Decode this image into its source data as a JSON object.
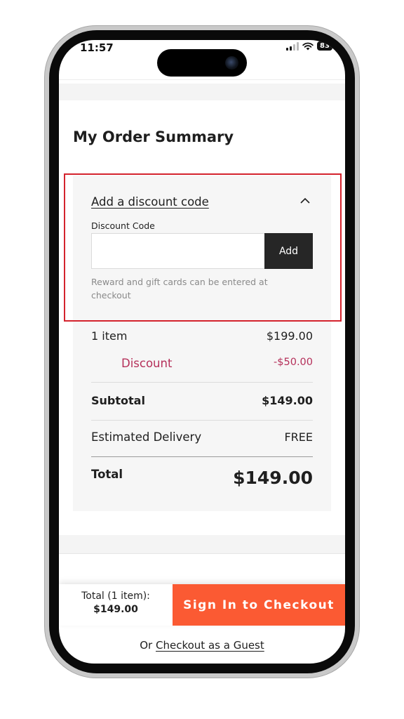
{
  "status_bar": {
    "time": "11:57",
    "battery": "83",
    "signal_icon": "cellular-signal-icon",
    "wifi_icon": "wifi-icon"
  },
  "order_summary": {
    "title": "My Order Summary"
  },
  "discount": {
    "toggle_label": "Add a discount code",
    "toggle_icon": "chevron-up-icon",
    "expanded": true,
    "field_label": "Discount Code",
    "input_value": "",
    "placeholder": "",
    "add_label": "Add",
    "hint": "Reward and gift cards can be entered at checkout"
  },
  "summary_rows": {
    "items_label": "1 item",
    "items_value": "$199.00",
    "discount_label": "Discount",
    "discount_value": "-$50.00",
    "subtotal_label": "Subtotal",
    "subtotal_value": "$149.00",
    "delivery_label": "Estimated Delivery",
    "delivery_value": "FREE",
    "total_label": "Total",
    "total_value": "$149.00"
  },
  "checkout_bar": {
    "total_label": "Total (1 item):",
    "total_value": "$149.00",
    "sign_in_label": "Sign In to Checkout"
  },
  "guest": {
    "prefix": "Or",
    "link_label": "Checkout as a Guest"
  },
  "colors": {
    "accent": "#fb5a33",
    "discount_text": "#b5305a",
    "highlight_border": "#d4232d",
    "add_button": "#262626"
  }
}
